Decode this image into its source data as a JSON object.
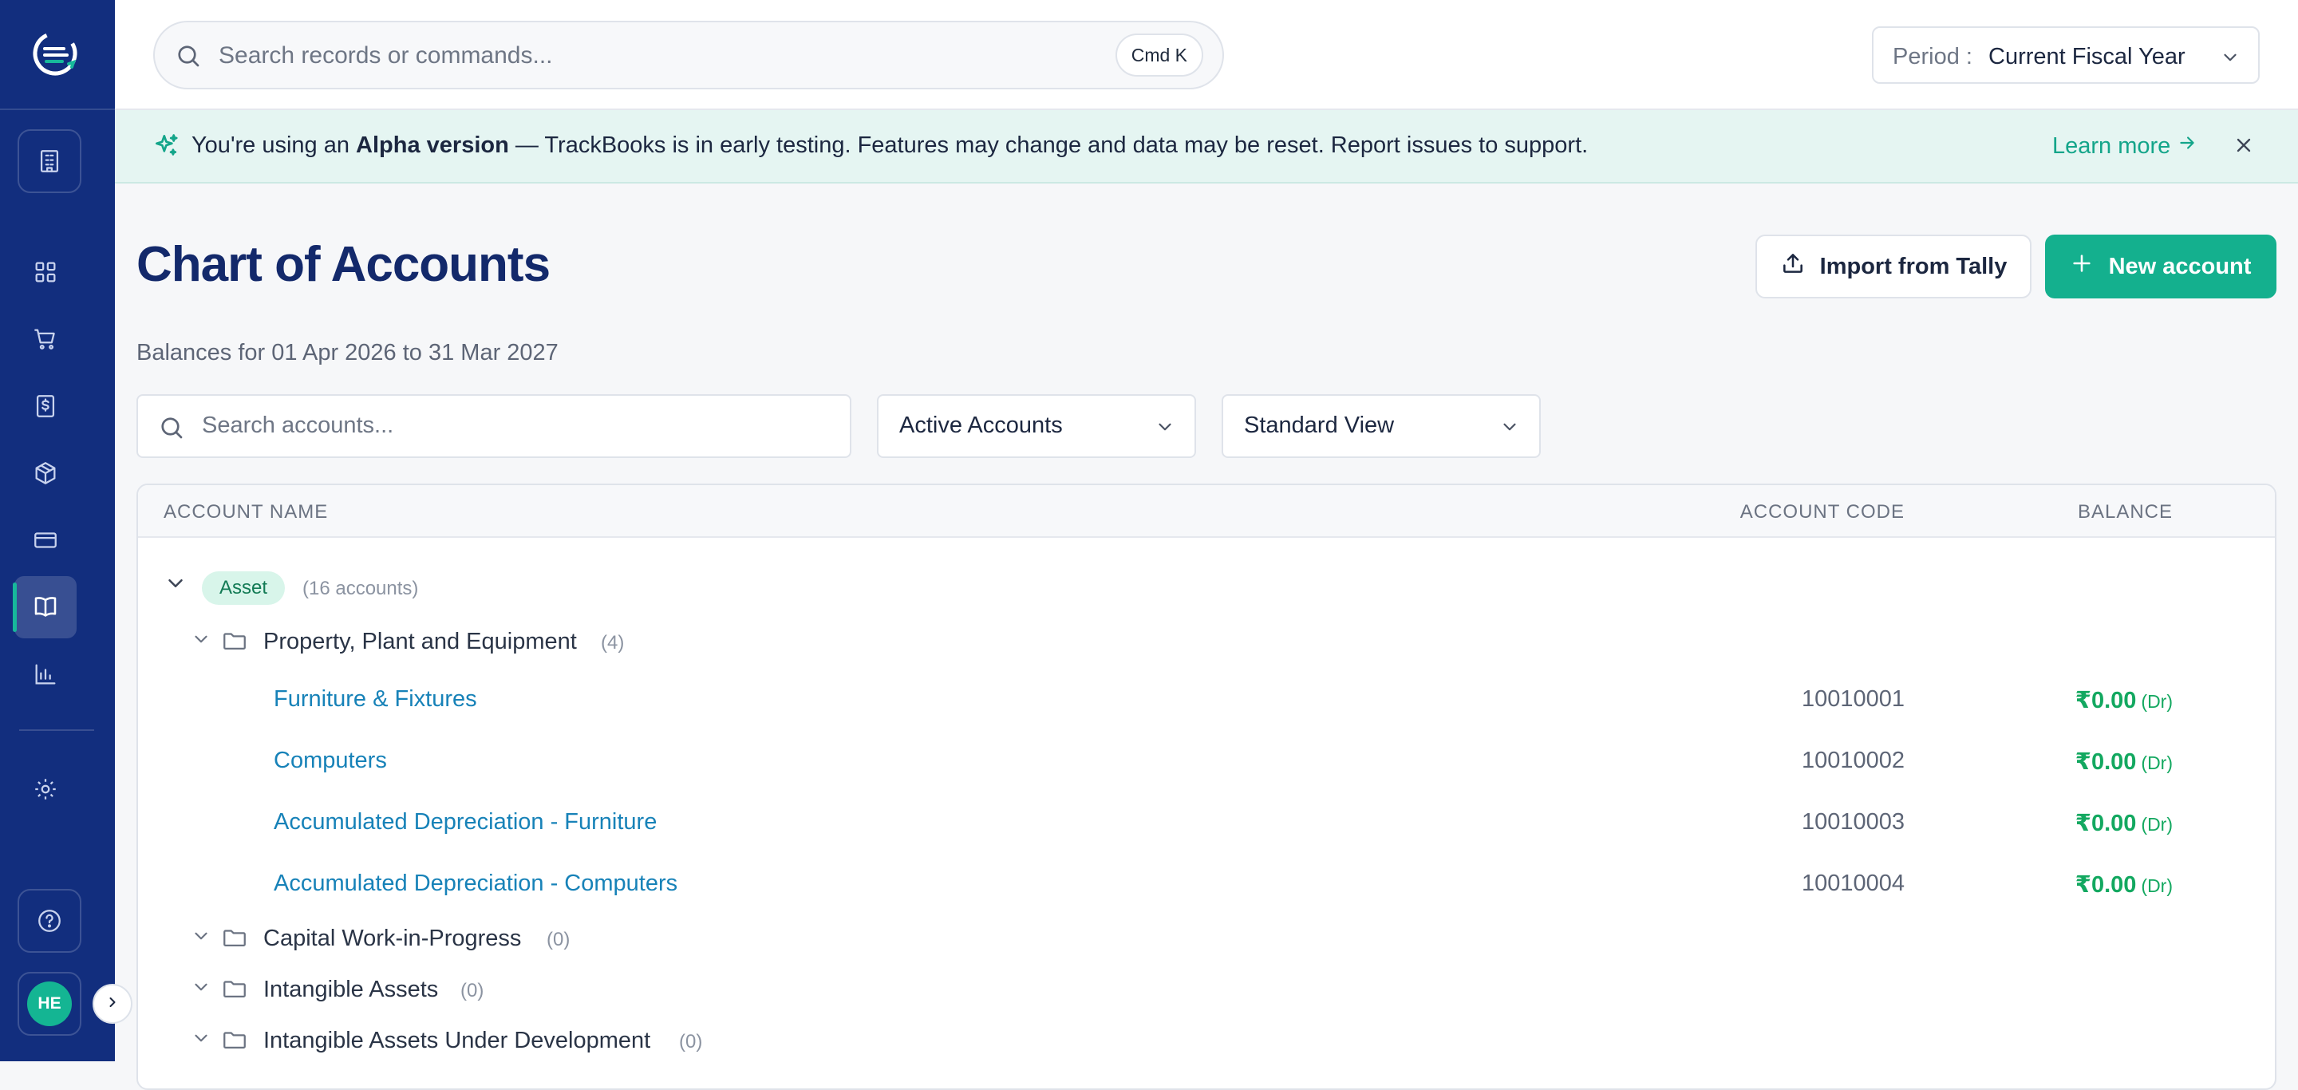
{
  "sidebar": {
    "items": [
      {
        "name": "dashboard",
        "icon": "grid-icon"
      },
      {
        "name": "sales",
        "icon": "cart-icon"
      },
      {
        "name": "purchases",
        "icon": "invoice-dollar-icon"
      },
      {
        "name": "inventory",
        "icon": "box-icon"
      },
      {
        "name": "banking",
        "icon": "card-icon"
      },
      {
        "name": "accounts",
        "icon": "book-icon",
        "active": true
      },
      {
        "name": "reports",
        "icon": "bar-chart-icon"
      }
    ],
    "avatar_initials": "HE"
  },
  "topbar": {
    "search_placeholder": "Search records or commands...",
    "shortcut": "Cmd K",
    "period_label": "Period :",
    "period_value": "Current Fiscal Year"
  },
  "banner": {
    "prefix": "You're using an ",
    "emphasis": "Alpha version",
    "suffix": " — TrackBooks is in early testing. Features may change and data may be reset. Report issues to support.",
    "link": "Learn more"
  },
  "page": {
    "title": "Chart of Accounts",
    "subtitle": "Balances for 01 Apr 2026 to 31 Mar 2027",
    "import_button": "Import from Tally",
    "new_button": "New account"
  },
  "filters": {
    "search_placeholder": "Search accounts...",
    "status_value": "Active Accounts",
    "view_value": "Standard View"
  },
  "table": {
    "headers": {
      "name": "ACCOUNT NAME",
      "code": "ACCOUNT CODE",
      "balance": "BALANCE"
    },
    "root": {
      "tag": "Asset",
      "count": "(16 accounts)"
    },
    "groups": [
      {
        "name": "Property, Plant and Equipment",
        "count": "(4)"
      },
      {
        "name": "Capital Work-in-Progress",
        "count": "(0)"
      },
      {
        "name": "Intangible Assets",
        "count": "(0)"
      },
      {
        "name": "Intangible Assets Under Development",
        "count": "(0)"
      }
    ],
    "accounts": [
      {
        "name": "Furniture & Fixtures",
        "code": "10010001",
        "balance": "₹0.00",
        "side": "(Dr)"
      },
      {
        "name": "Computers",
        "code": "10010002",
        "balance": "₹0.00",
        "side": "(Dr)"
      },
      {
        "name": "Accumulated Depreciation - Furniture",
        "code": "10010003",
        "balance": "₹0.00",
        "side": "(Dr)"
      },
      {
        "name": "Accumulated Depreciation - Computers",
        "code": "10010004",
        "balance": "₹0.00",
        "side": "(Dr)"
      }
    ]
  },
  "colors": {
    "sidebar": "#122e7e",
    "accent": "#14b08e",
    "link": "#1782b8",
    "balance": "#13a860",
    "title": "#13296b"
  }
}
